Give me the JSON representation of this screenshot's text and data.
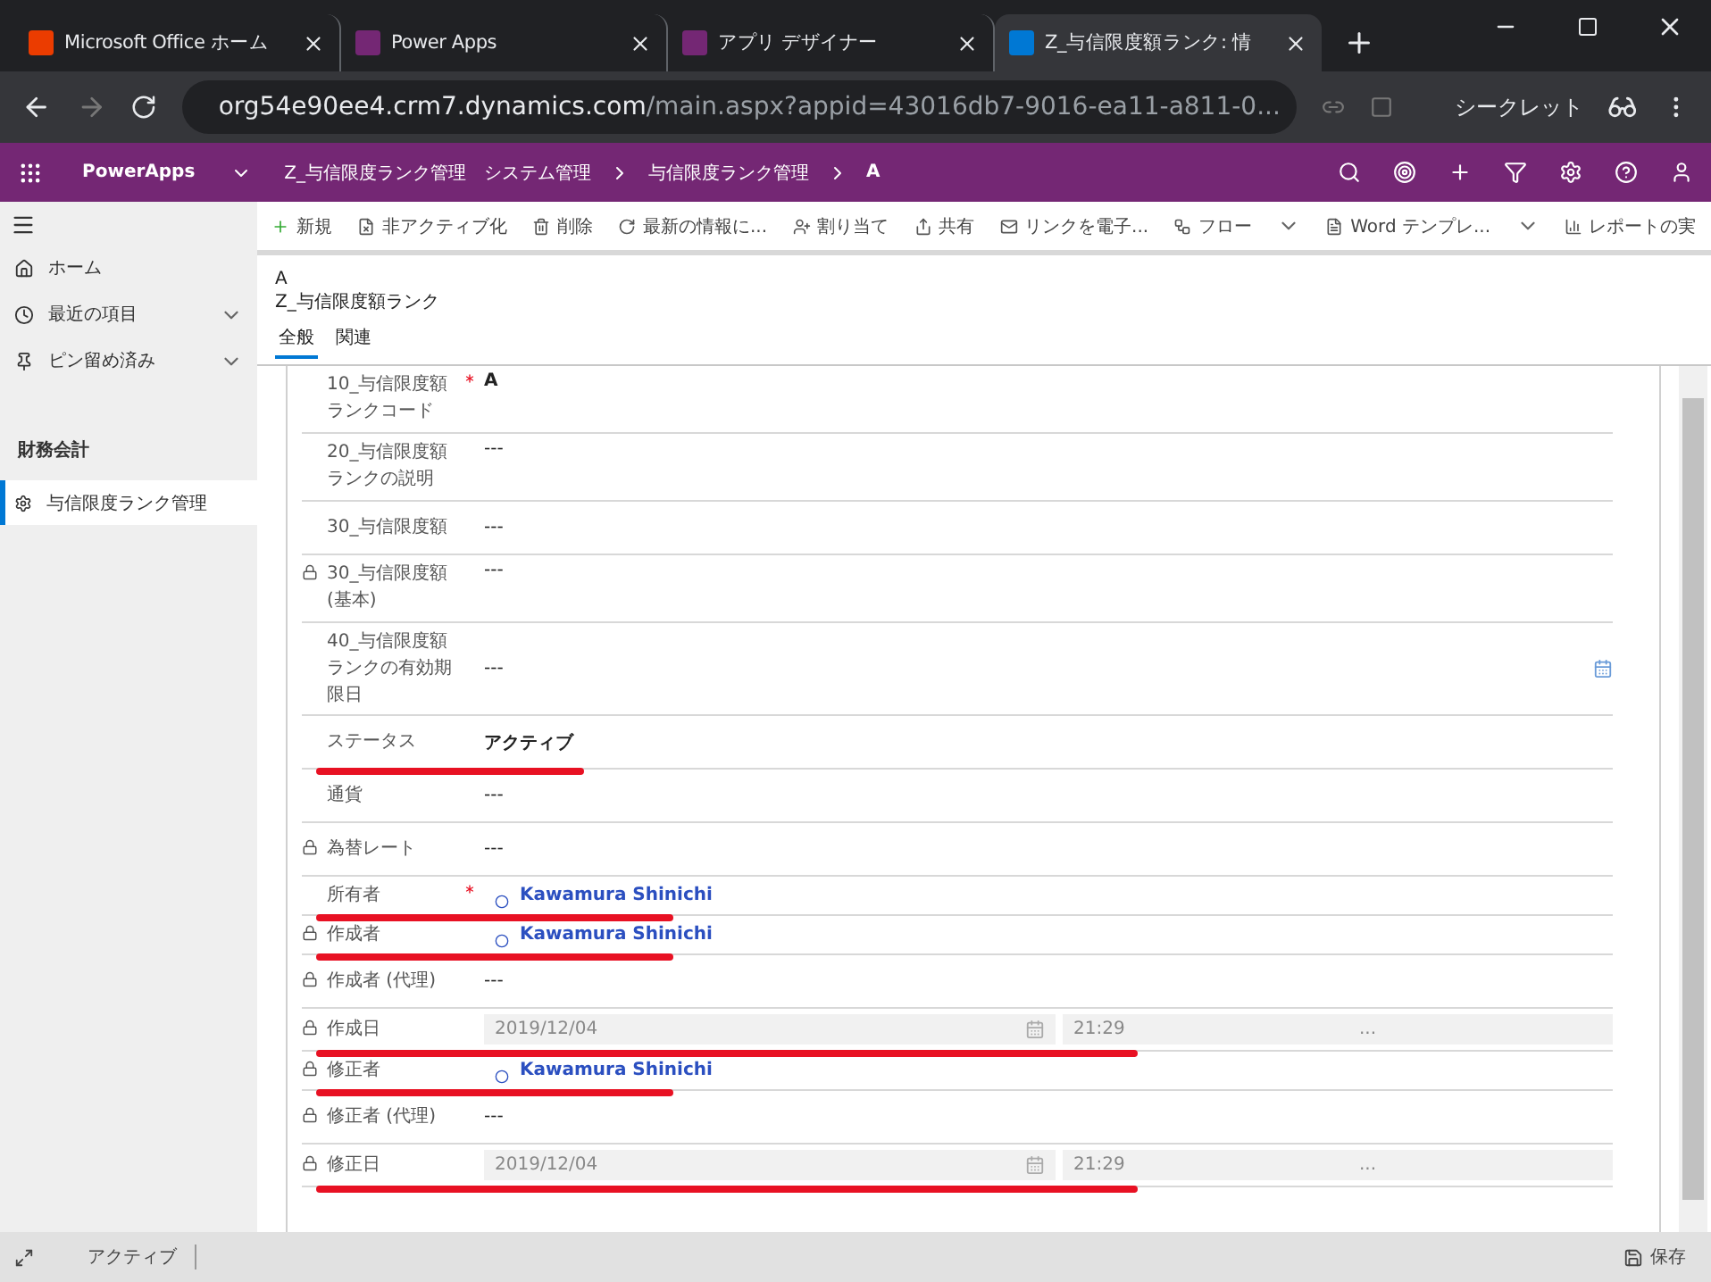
{
  "browser": {
    "tabs": [
      {
        "title": "Microsoft Office ホーム",
        "selected": false
      },
      {
        "title": "Power Apps",
        "selected": false
      },
      {
        "title": "アプリ デザイナー",
        "selected": false
      },
      {
        "title": "Z_与信限度額ランク: 情",
        "selected": true
      }
    ],
    "url_host": "org54e90ee4.crm7.dynamics.com",
    "url_path": "/main.aspx?appid=43016db7-9016-ea11-a811-0...",
    "profile": "シークレット"
  },
  "app_header": {
    "brand": "PowerApps",
    "app_name": "Z_与信限度ランク管理",
    "breadcrumbs": [
      "システム管理",
      "与信限度ランク管理",
      "A"
    ]
  },
  "sidebar": {
    "items": [
      {
        "label": "ホーム",
        "expandable": false
      },
      {
        "label": "最近の項目",
        "expandable": true
      },
      {
        "label": "ピン留め済み",
        "expandable": true
      }
    ],
    "group": "財務会計",
    "entities": [
      {
        "label": "与信限度ランク管理",
        "selected": true
      }
    ]
  },
  "command_bar": [
    {
      "label": "新規",
      "dropdown": false
    },
    {
      "label": "非アクティブ化",
      "dropdown": false
    },
    {
      "label": "削除",
      "dropdown": false
    },
    {
      "label": "最新の情報に...",
      "dropdown": false
    },
    {
      "label": "割り当て",
      "dropdown": false
    },
    {
      "label": "共有",
      "dropdown": false
    },
    {
      "label": "リンクを電子...",
      "dropdown": false
    },
    {
      "label": "フロー",
      "dropdown": true
    },
    {
      "label": "Word テンプレ...",
      "dropdown": true
    },
    {
      "label": "レポートの実",
      "dropdown": false
    }
  ],
  "record": {
    "title": "A",
    "entity": "Z_与信限度額ランク",
    "tabs": [
      {
        "label": "全般",
        "selected": true
      },
      {
        "label": "関連",
        "selected": false
      }
    ]
  },
  "fields": [
    {
      "kind": "text",
      "label": "10_与信限度額ランクコード",
      "value": "A",
      "bold": true,
      "locked": false,
      "required": true,
      "underlined": false
    },
    {
      "kind": "text",
      "label": "20_与信限度額ランクの説明",
      "value": "---",
      "bold": false,
      "locked": false,
      "required": false,
      "underlined": false
    },
    {
      "kind": "text",
      "label": "30_与信限度額",
      "value": "---",
      "bold": false,
      "locked": false,
      "required": false,
      "underlined": false
    },
    {
      "kind": "text",
      "label": "30_与信限度額 (基本)",
      "value": "---",
      "bold": false,
      "locked": true,
      "required": false,
      "underlined": false
    },
    {
      "kind": "date",
      "label": "40_与信限度額ランクの有効期限日",
      "value": "---",
      "locked": false,
      "required": false,
      "underlined": false
    },
    {
      "kind": "text",
      "label": "ステータス",
      "value": "アクティブ",
      "bold": true,
      "locked": false,
      "required": false,
      "underlined": true
    },
    {
      "kind": "text",
      "label": "通貨",
      "value": "---",
      "bold": false,
      "locked": false,
      "required": false,
      "underlined": false
    },
    {
      "kind": "text",
      "label": "為替レート",
      "value": "---",
      "bold": false,
      "locked": true,
      "required": false,
      "underlined": false
    },
    {
      "kind": "lookup",
      "label": "所有者",
      "value": "Kawamura Shinichi",
      "locked": false,
      "required": true,
      "underlined": true
    },
    {
      "kind": "lookup",
      "label": "作成者",
      "value": "Kawamura Shinichi",
      "locked": true,
      "required": false,
      "underlined": true
    },
    {
      "kind": "text",
      "label": "作成者 (代理)",
      "value": "---",
      "bold": false,
      "locked": true,
      "required": false,
      "underlined": false
    },
    {
      "kind": "datetime",
      "label": "作成日",
      "date": "2019/12/04",
      "time": "21:29",
      "more": "...",
      "locked": true,
      "required": false,
      "underlined": true
    },
    {
      "kind": "lookup",
      "label": "修正者",
      "value": "Kawamura Shinichi",
      "locked": true,
      "required": false,
      "underlined": true
    },
    {
      "kind": "text",
      "label": "修正者 (代理)",
      "value": "---",
      "bold": false,
      "locked": true,
      "required": false,
      "underlined": false
    },
    {
      "kind": "datetime",
      "label": "修正日",
      "date": "2019/12/04",
      "time": "21:29",
      "more": "...",
      "locked": true,
      "required": false,
      "underlined": true
    }
  ],
  "status_bar": {
    "status": "アクティブ",
    "save": "保存"
  }
}
